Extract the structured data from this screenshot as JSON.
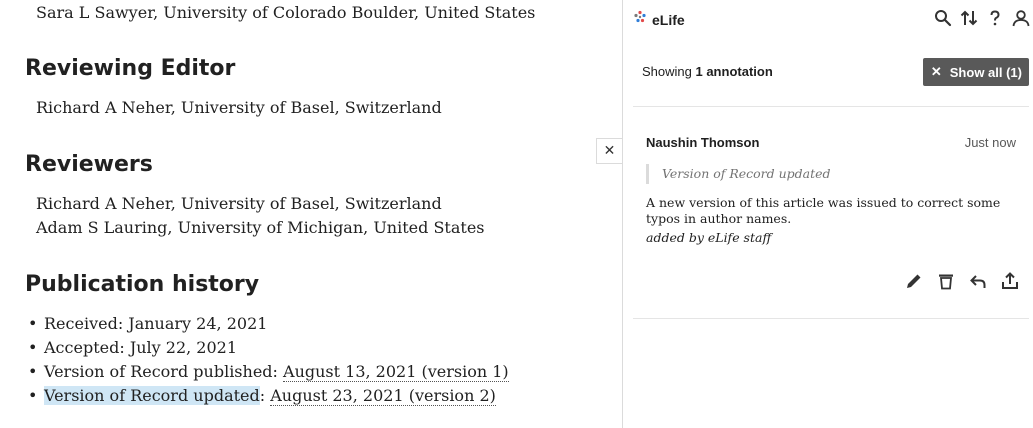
{
  "article": {
    "author_line": "Sara L Sawyer, University of Colorado Boulder, United States",
    "reviewing_editor_heading": "Reviewing Editor",
    "reviewing_editor": "Richard A Neher, University of Basel, Switzerland",
    "reviewers_heading": "Reviewers",
    "reviewers": [
      "Richard A Neher, University of Basel, Switzerland",
      "Adam S Lauring, University of Michigan, United States"
    ],
    "history_heading": "Publication history",
    "history": [
      {
        "label": "Received: ",
        "value": "January 24, 2021"
      },
      {
        "label": "Accepted: ",
        "value": "July 22, 2021"
      },
      {
        "label": "Version of Record published: ",
        "value": "August 13, 2021 (version 1)"
      },
      {
        "label": "Version of Record updated",
        "sep": ": ",
        "value": "August 23, 2021 (version 2)"
      }
    ]
  },
  "close_tab": {
    "label": "✕"
  },
  "sidebar": {
    "brand": "eLife",
    "icons": [
      "search-icon",
      "sort-icon",
      "help-icon",
      "user-icon"
    ],
    "filter": {
      "prefix": "Showing ",
      "count": "1 annotation",
      "button_label": "Show all (1)",
      "button_icon": "✕"
    },
    "annotation": {
      "author": "Naushin Thomson",
      "timestamp": "Just now",
      "quote": "Version of Record updated",
      "body": "A new version of this article was issued to correct some typos in author names.",
      "signature": "added by eLife staff",
      "actions": [
        "edit-icon",
        "delete-icon",
        "reply-icon",
        "share-icon"
      ]
    }
  },
  "colors": {
    "highlight": "#cfe6f5",
    "button_bg": "#595959",
    "brand_dots": [
      "#e24a4a",
      "#2f7ed8",
      "#7a7a7a"
    ]
  }
}
